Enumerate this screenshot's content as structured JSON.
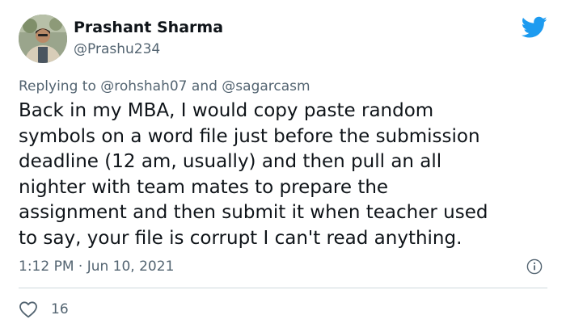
{
  "author": {
    "display_name": "Prashant Sharma",
    "handle": "@Prashu234",
    "avatar": "profile-photo"
  },
  "header_icon": "twitter-bird-icon",
  "reply_context": {
    "prefix": "Replying to",
    "mention_1": "@rohshah07",
    "joiner": "and",
    "mention_2": "@sagarcasm"
  },
  "tweet": {
    "lines": [
      "Back in my MBA, I would copy paste random",
      "symbols on a word file just before the submission",
      "deadline (12 am, usually) and then pull an all",
      "nighter with team mates to prepare the",
      "assignment and then submit it when teacher used",
      "to say, your file is corrupt I can't read anything."
    ]
  },
  "meta": {
    "timestamp": "1:12 PM · Jun 10, 2021",
    "info_icon": "info-icon"
  },
  "engagement": {
    "like_icon": "heart-icon",
    "likes": "16"
  },
  "colors": {
    "text": "#0f1419",
    "secondary": "#536471",
    "twitter_blue": "#1d9bf0",
    "divider": "#cfd9de"
  }
}
